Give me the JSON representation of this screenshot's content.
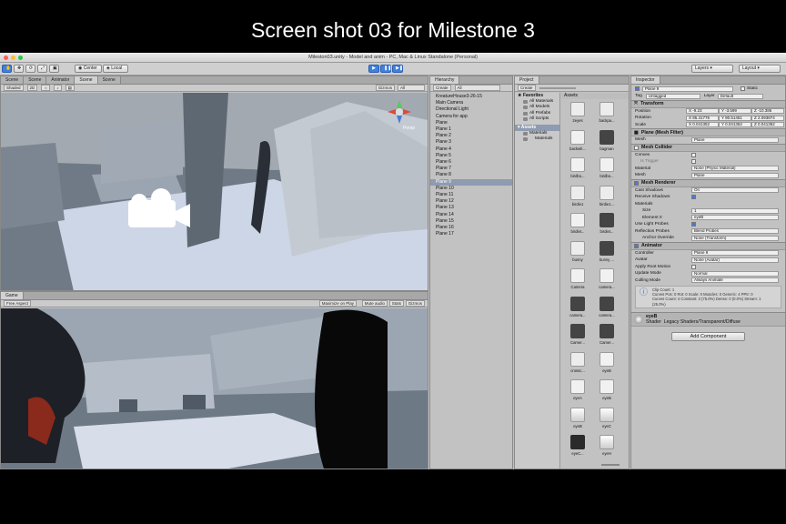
{
  "caption": "Screen shot 03 for Milestone 3",
  "window": {
    "title": "Mileston03.unity - Model and anim - PC, Mac & Linux Standalone (Personal)"
  },
  "toolbar": {
    "center": "Center",
    "local": "Local",
    "layers": "Layers",
    "layout": "Layout"
  },
  "scene": {
    "tabs": [
      "Scene",
      "Scene",
      "Animator",
      "Scene",
      "Scene"
    ],
    "shading": "Shaded",
    "mode_2d": "2D",
    "gizmos": "Gizmos",
    "search_placeholder": "All",
    "gizmo_label": "Persp"
  },
  "game": {
    "tab": "Game",
    "aspect": "Free Aspect",
    "maximize": "Maximize on Play",
    "mute": "Mute audio",
    "stats": "Stats",
    "gizmos": "Gizmos"
  },
  "hierarchy": {
    "tab": "Hierarchy",
    "create": "Create",
    "search_placeholder": "All",
    "items": [
      "KreatureHouse3-26-15",
      "Main Camera",
      "Directional Light",
      "Camera for app",
      "Plane",
      "Plane 1",
      "Plane 2",
      "Plane 3",
      "Plane 4",
      "Plane 5",
      "Plane 6",
      "Plane 7",
      "Plane 8",
      "Plane 9",
      "Plane 10",
      "Plane 11",
      "Plane 12",
      "Plane 13",
      "Plane 14",
      "Plane 15",
      "Plane 16",
      "Plane 17"
    ],
    "selected_index": 13
  },
  "project": {
    "tab": "Project",
    "create": "Create",
    "favorites_title": "Favorites",
    "favorites": [
      "All Materials",
      "All Models",
      "All Prefabs",
      "All Scripts"
    ],
    "assets_root": "Assets",
    "folders": [
      "Materials",
      "Materials"
    ],
    "grid_title": "Assets",
    "assets": [
      {
        "name": "2eyes",
        "kind": "fig"
      },
      {
        "name": "backpa...",
        "kind": "fig"
      },
      {
        "name": "backwh...",
        "kind": "doc"
      },
      {
        "name": "bagman",
        "kind": "unity"
      },
      {
        "name": "birdbo...",
        "kind": "doc"
      },
      {
        "name": "birdbo...",
        "kind": "doc"
      },
      {
        "name": "birdie1",
        "kind": "fig"
      },
      {
        "name": "birdie1...",
        "kind": "fig"
      },
      {
        "name": "birdiet...",
        "kind": "doc"
      },
      {
        "name": "birdiet...",
        "kind": "unity"
      },
      {
        "name": "bunny",
        "kind": "fig"
      },
      {
        "name": "bunny ...",
        "kind": "unity"
      },
      {
        "name": "Camera",
        "kind": "doc"
      },
      {
        "name": "camera...",
        "kind": "doc"
      },
      {
        "name": "camera...",
        "kind": "unity"
      },
      {
        "name": "camera...",
        "kind": "unity"
      },
      {
        "name": "Camer...",
        "kind": "unity"
      },
      {
        "name": "Camer...",
        "kind": "unity"
      },
      {
        "name": "crossc...",
        "kind": "fig"
      },
      {
        "name": "eyeB",
        "kind": "doc"
      },
      {
        "name": "eyeA",
        "kind": "doc"
      },
      {
        "name": "eyeB",
        "kind": "doc"
      },
      {
        "name": "eyeB",
        "kind": "png"
      },
      {
        "name": "eyeC",
        "kind": "png"
      },
      {
        "name": "eyeC...",
        "kind": "cam"
      },
      {
        "name": "eyeH",
        "kind": "png"
      }
    ]
  },
  "inspector": {
    "tab": "Inspector",
    "object_name": "Plane 9",
    "static_label": "Static",
    "tag_label": "Tag",
    "tag_value": "Untagged",
    "layer_label": "Layer",
    "layer_value": "Default",
    "transform": {
      "title": "Transform",
      "position_label": "Position",
      "position": [
        "X -9.23",
        "Y -3.599",
        "Z -10.386"
      ],
      "rotation_label": "Rotation",
      "rotation": [
        "X 85.41776",
        "Y 90.51451",
        "Z 2.093874"
      ],
      "scale_label": "Scale",
      "scale": [
        "X 0.041352",
        "Y 0.041352",
        "Z 0.041352"
      ]
    },
    "mesh_filter": {
      "title": "Plane (Mesh Filter)",
      "mesh_label": "Mesh",
      "mesh_value": "Plane"
    },
    "mesh_collider": {
      "title": "Mesh Collider",
      "convex": "Convex",
      "trigger": "Is Trigger",
      "material_label": "Material",
      "material_value": "None (Physic Material)",
      "mesh_label": "Mesh",
      "mesh_value": "Plane"
    },
    "mesh_renderer": {
      "title": "Mesh Renderer",
      "cast_label": "Cast Shadows",
      "cast_value": "On",
      "receive_label": "Receive Shadows",
      "materials_label": "Materials",
      "size_label": "Size",
      "size_value": "1",
      "element_label": "Element 0",
      "element_value": "eyeB",
      "probes_label": "Use Light Probes",
      "reflection_label": "Reflection Probes",
      "reflection_value": "Blend Probes",
      "anchor_label": "Anchor Override",
      "anchor_value": "None (Transform)"
    },
    "animator": {
      "title": "Animator",
      "controller_label": "Controller",
      "controller_value": "Plane 9",
      "avatar_label": "Avatar",
      "avatar_value": "None (Avatar)",
      "root_label": "Apply Root Motion",
      "update_label": "Update Mode",
      "update_value": "Normal",
      "culling_label": "Culling Mode",
      "culling_value": "Always Animate",
      "info": [
        "Clip Count: 1",
        "Curves Pos: 0 Rot: 0 Scale: 0 Muscles: 0 Generic: 4 PPtr: 0",
        "Curves Count: 4 Constant: 3 (75.0%) Dense: 0 (0.0%) Stream: 1",
        "(25.0%)"
      ]
    },
    "material": {
      "name": "eyeB",
      "shader_label": "Shader",
      "shader_value": "Legacy Shaders/Transparent/Diffuse"
    },
    "add_component": "Add Component"
  }
}
